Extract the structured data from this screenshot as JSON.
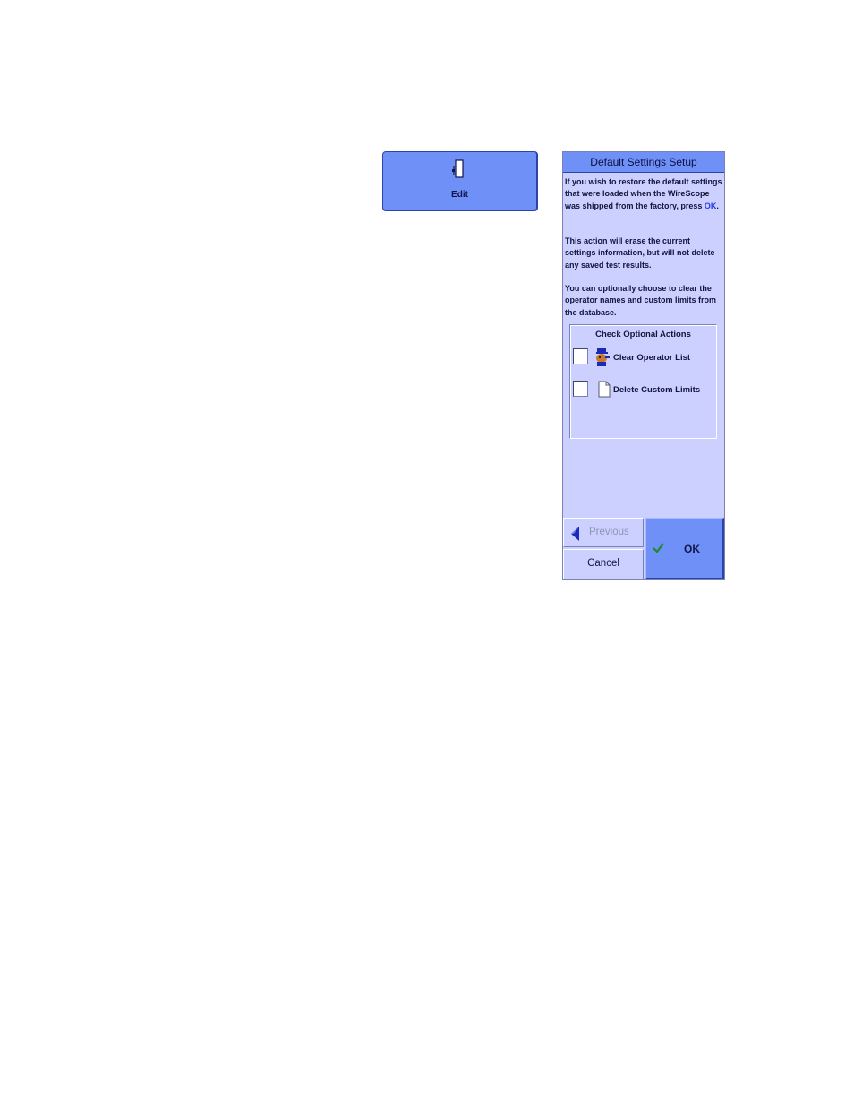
{
  "edit_button": {
    "label": "Edit",
    "icon": "edit-icon"
  },
  "dialog": {
    "title": "Default Settings Setup",
    "paragraphs": {
      "p1_text": "If you wish to restore the default settings that were loaded when the WireScope was shipped from the factory, press ",
      "p1_link": "OK",
      "p1_end": ".",
      "p2": "This action will erase the current settings information, but will not delete any saved test results.",
      "p3": "You can optionally choose to clear the operator names and custom limits from the database."
    },
    "options": {
      "title": "Check Optional Actions",
      "items": [
        {
          "label": "Clear Operator List",
          "checked": false,
          "icon": "operator-icon"
        },
        {
          "label": "Delete Custom Limits",
          "checked": false,
          "icon": "document-icon"
        }
      ]
    },
    "buttons": {
      "previous": "Previous",
      "cancel": "Cancel",
      "ok": "OK"
    }
  },
  "colors": {
    "dialog_bg": "#cbd0ff",
    "button_blue": "#6f90f6",
    "link_blue": "#2a3ae0",
    "check_green": "#1f8a2e"
  }
}
